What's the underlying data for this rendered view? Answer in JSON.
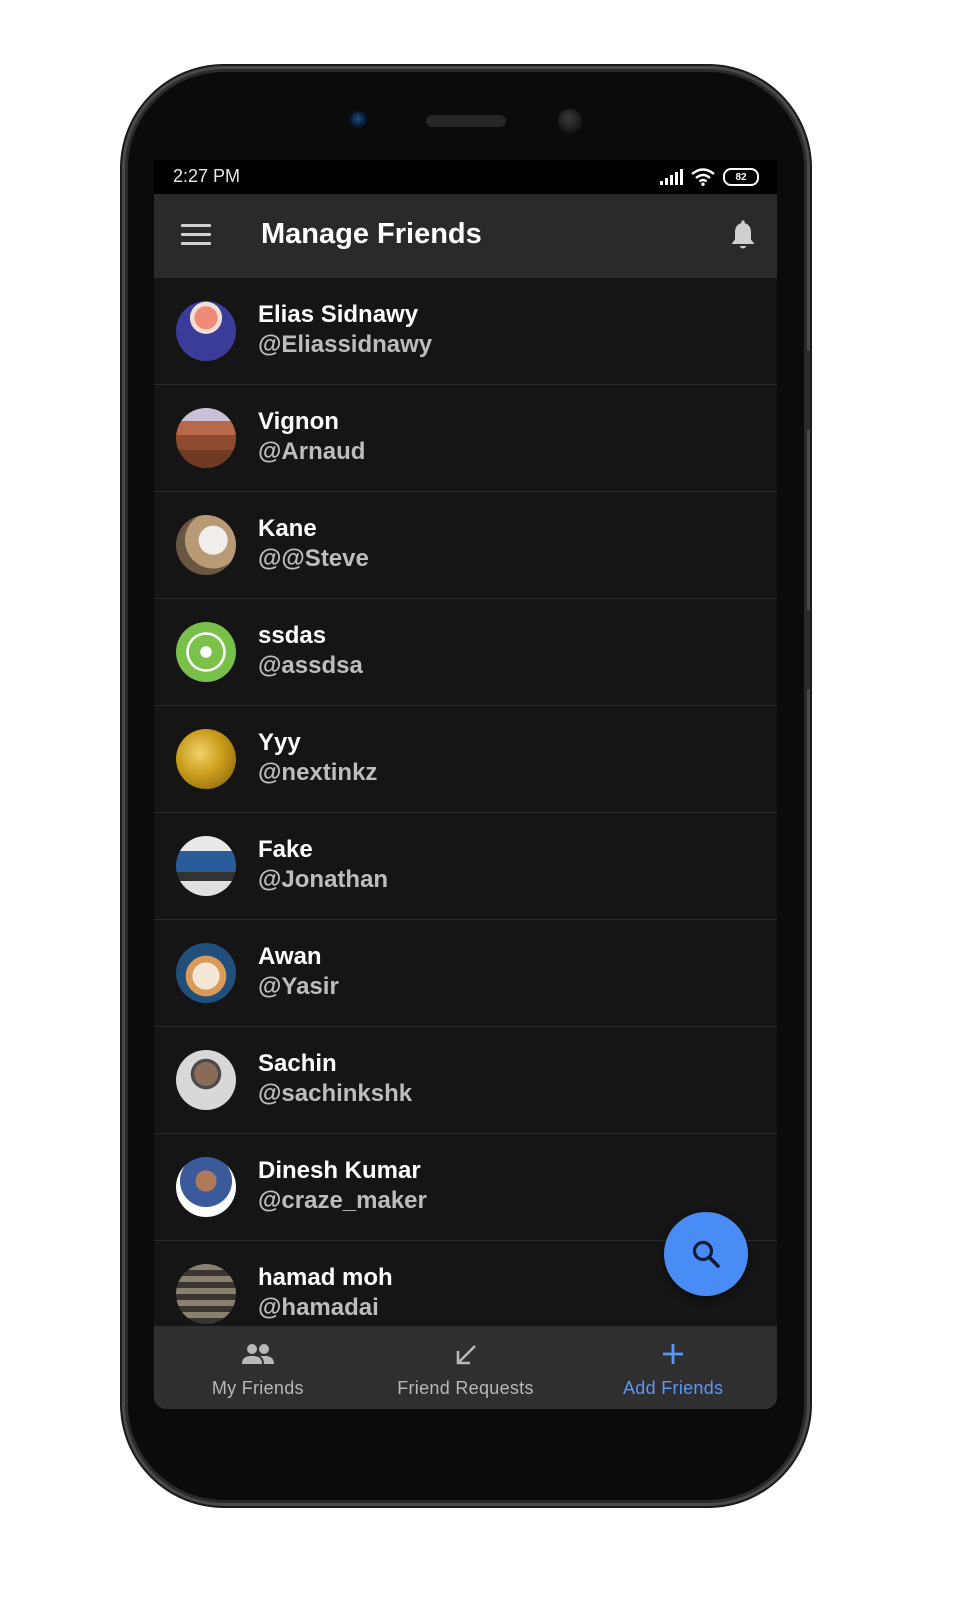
{
  "statusbar": {
    "time": "2:27 PM",
    "battery": "82"
  },
  "appbar": {
    "title": "Manage Friends"
  },
  "friends": [
    {
      "name": "Elias Sidnawy",
      "handle": "@Eliassidnawy"
    },
    {
      "name": "Vignon",
      "handle": "@Arnaud"
    },
    {
      "name": "Kane",
      "handle": "@@Steve"
    },
    {
      "name": "ssdas",
      "handle": "@assdsa"
    },
    {
      "name": "Yyy",
      "handle": "@nextinkz"
    },
    {
      "name": "Fake",
      "handle": "@Jonathan"
    },
    {
      "name": "Awan",
      "handle": "@Yasir"
    },
    {
      "name": "Sachin",
      "handle": "@sachinkshk"
    },
    {
      "name": "Dinesh Kumar",
      "handle": "@craze_maker"
    },
    {
      "name": "hamad moh",
      "handle": "@hamadai"
    }
  ],
  "bottomnav": {
    "items": [
      {
        "label": "My Friends",
        "icon": "people-icon",
        "active": false
      },
      {
        "label": "Friend Requests",
        "icon": "arrow-down-left-icon",
        "active": false
      },
      {
        "label": "Add Friends",
        "icon": "plus-icon",
        "active": true
      }
    ]
  },
  "colors": {
    "accent": "#4a8cf5",
    "appbar": "#2a2a2a",
    "list_bg": "#151515",
    "nav_bg": "#2f2f2f"
  }
}
